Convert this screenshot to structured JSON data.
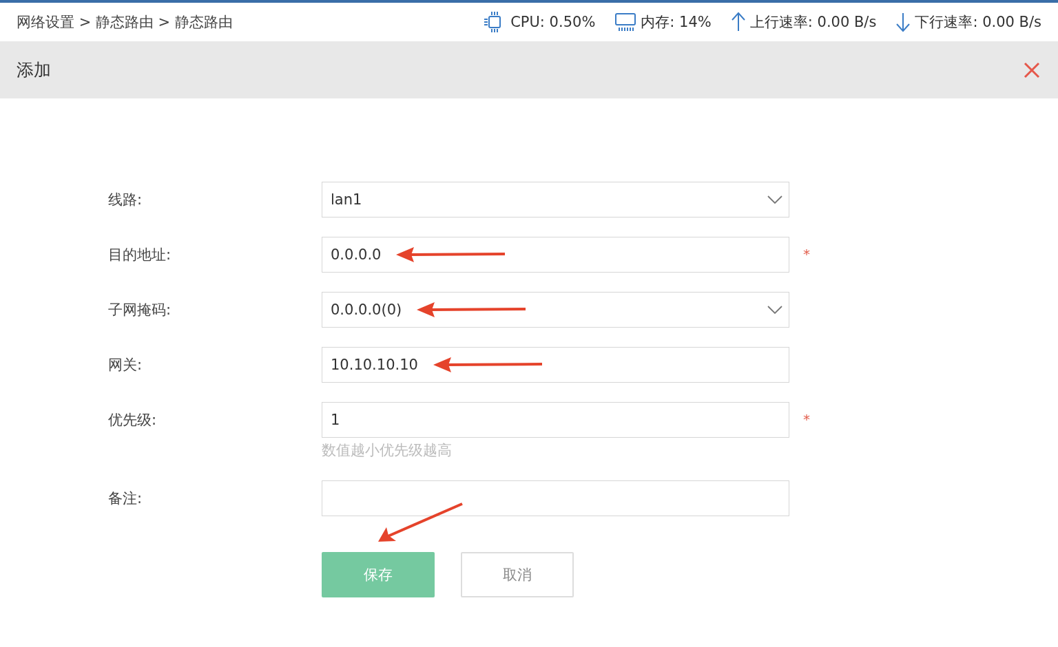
{
  "breadcrumb": "网络设置 > 静态路由 > 静态路由",
  "stats": [
    {
      "kind": "cpu",
      "text": "CPU: 0.50%"
    },
    {
      "kind": "memory",
      "text": "内存: 14%"
    },
    {
      "kind": "up",
      "text": "上行速率: 0.00 B/s"
    },
    {
      "kind": "down",
      "text": "下行速率: 0.00 B/s"
    }
  ],
  "dialog": {
    "title": "添加"
  },
  "fields": [
    {
      "label": "线路:",
      "kind": "select",
      "value": "lan1",
      "arrow": false
    },
    {
      "label": "目的地址:",
      "kind": "text",
      "value": "0.0.0.0",
      "required_mark": "*",
      "arrow": true
    },
    {
      "label": "子网掩码:",
      "kind": "select",
      "value": "0.0.0.0(0)",
      "arrow": true
    },
    {
      "label": "网关:",
      "kind": "text",
      "value": "10.10.10.10",
      "arrow": true
    },
    {
      "label": "优先级:",
      "kind": "text",
      "value": "1",
      "required_mark": "*",
      "arrow": false,
      "hint": "数值越小优先级越高"
    },
    {
      "label": "备注:",
      "kind": "text",
      "arrow": false
    }
  ],
  "buttons": [
    {
      "label": "保存",
      "kind": "primary",
      "arrow": true
    },
    {
      "label": "取消",
      "kind": "default",
      "arrow": false
    }
  ]
}
